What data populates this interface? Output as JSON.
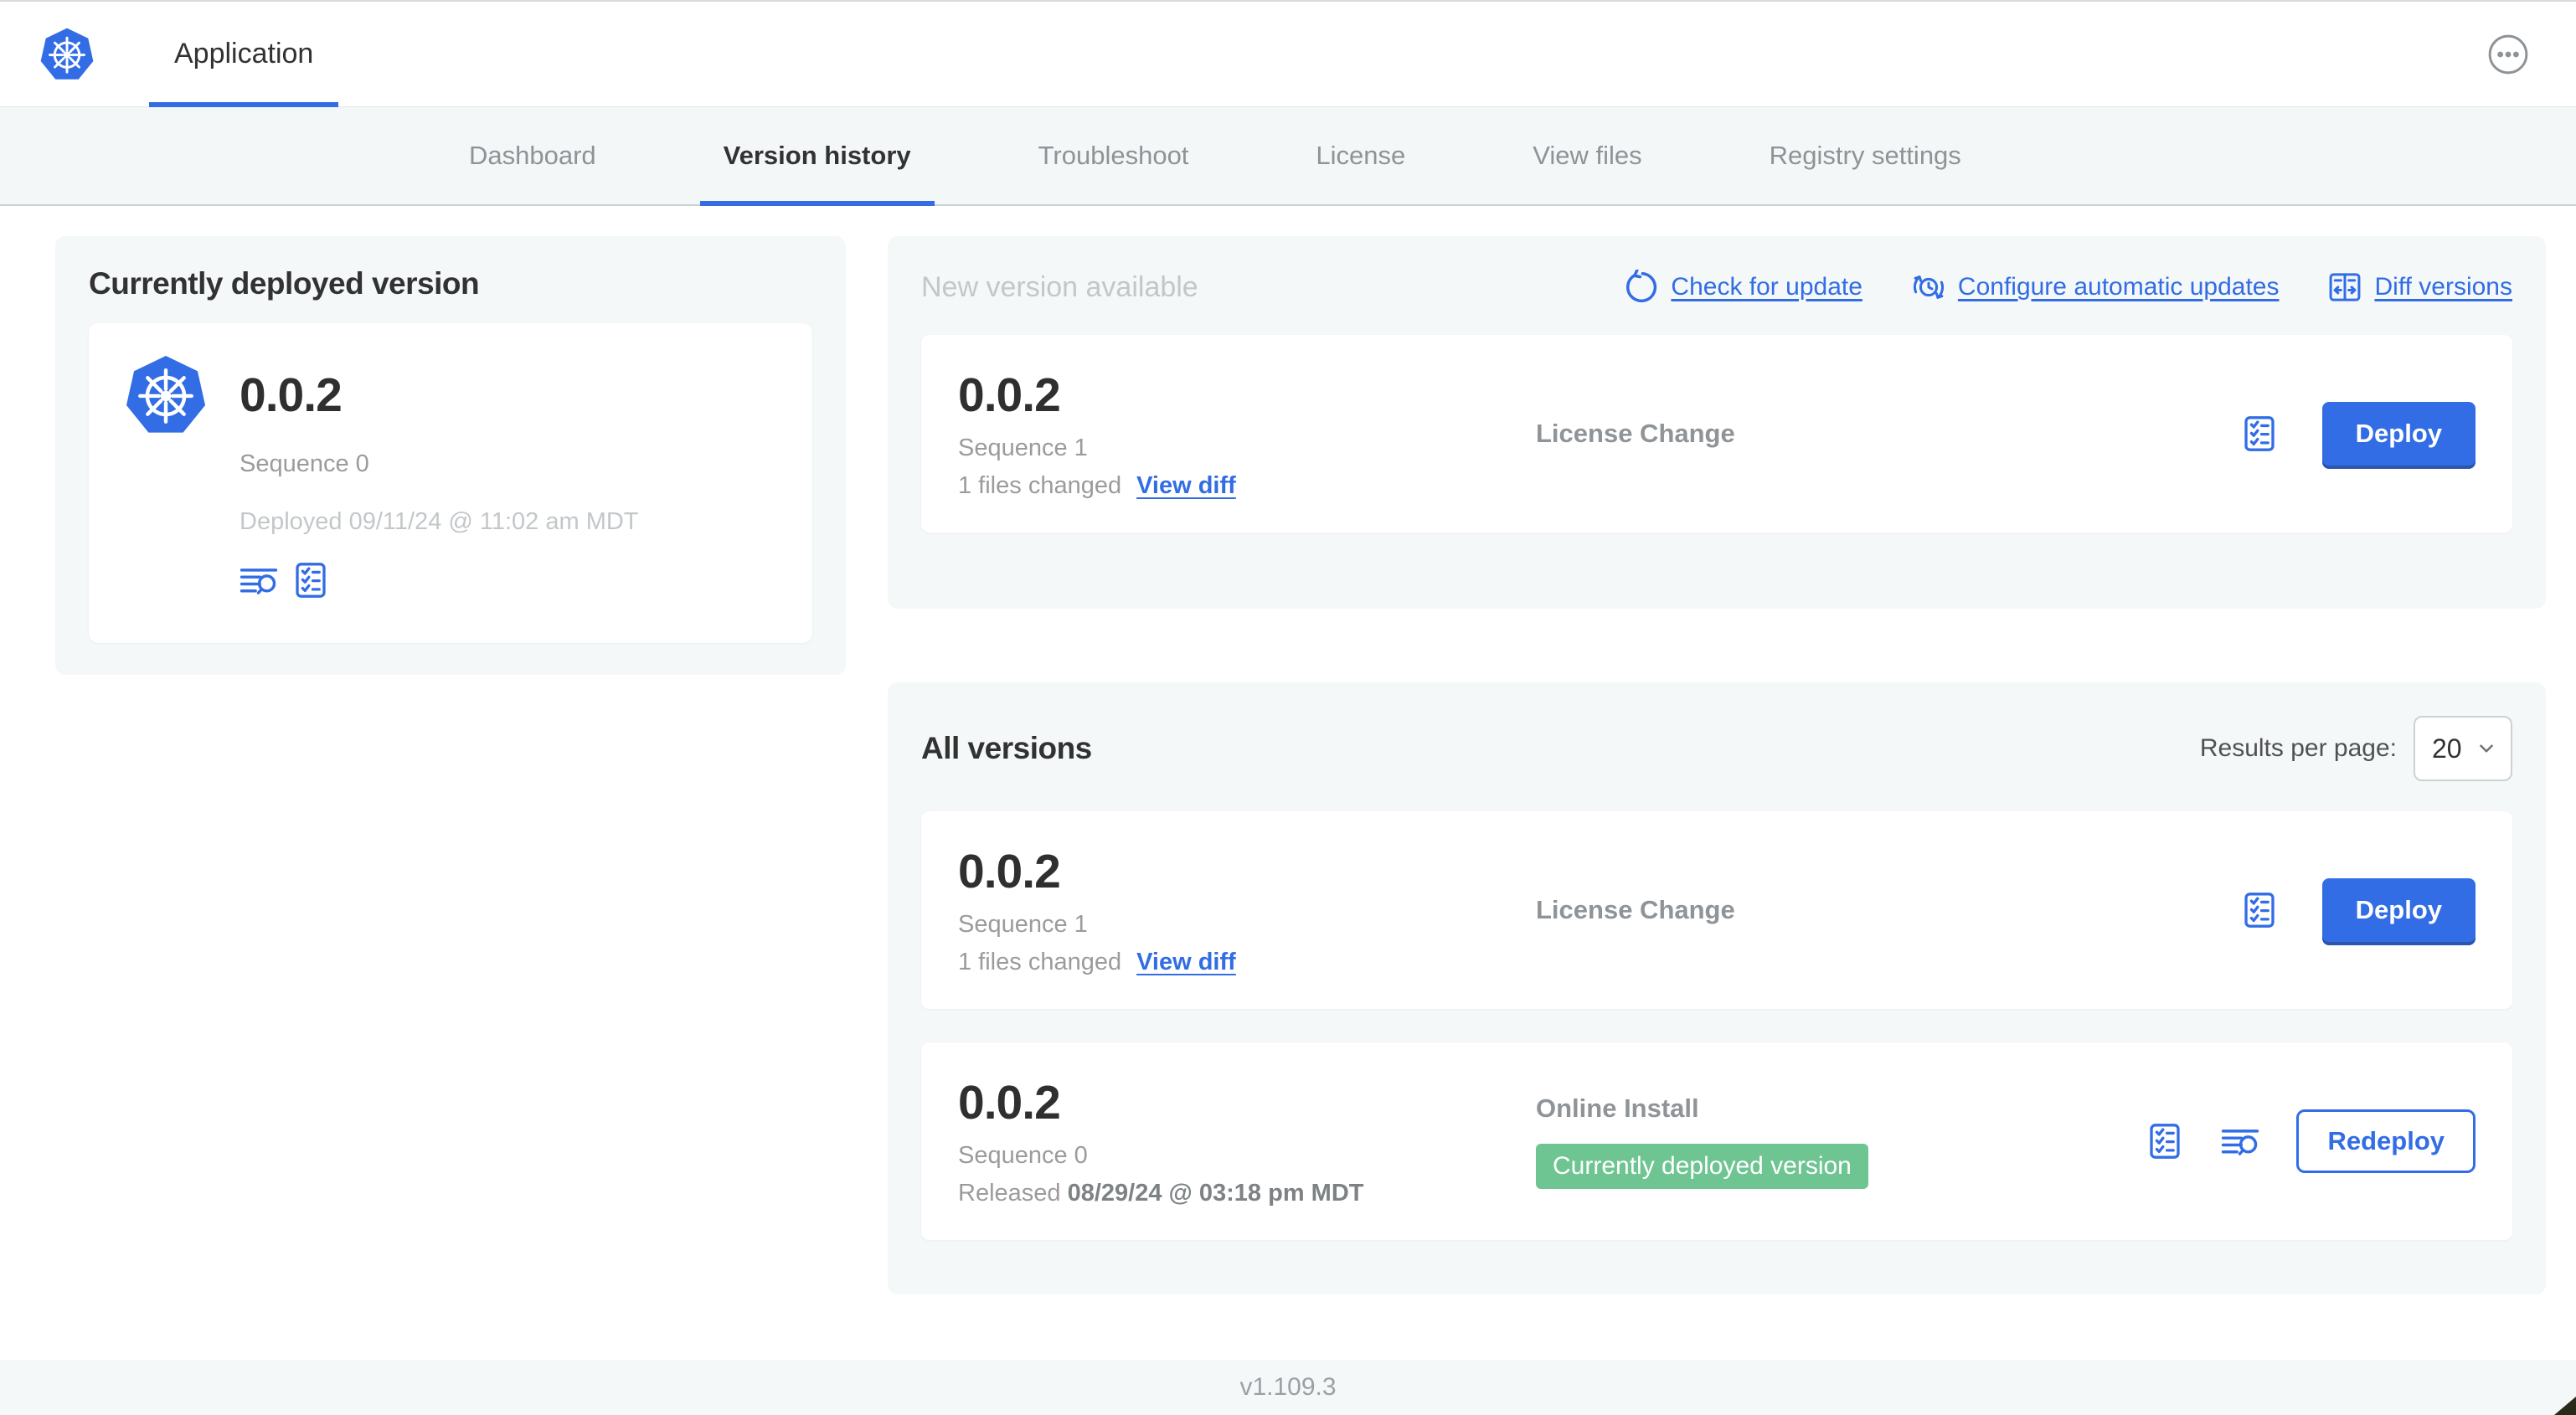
{
  "header": {
    "app_tab_label": "Application"
  },
  "nav": {
    "tabs": [
      {
        "label": "Dashboard"
      },
      {
        "label": "Version history"
      },
      {
        "label": "Troubleshoot"
      },
      {
        "label": "License"
      },
      {
        "label": "View files"
      },
      {
        "label": "Registry settings"
      }
    ]
  },
  "current_version_panel": {
    "title": "Currently deployed version",
    "version": "0.0.2",
    "sequence": "Sequence 0",
    "deployed_timestamp": "Deployed 09/11/24 @ 11:02 am MDT"
  },
  "new_version_panel": {
    "title": "New version available",
    "check_for_update_label": "Check for update",
    "configure_updates_label": "Configure automatic updates",
    "diff_versions_label": "Diff versions",
    "row": {
      "version": "0.0.2",
      "sequence": "Sequence 1",
      "files_changed": "1 files changed",
      "view_diff_label": "View diff",
      "source": "License Change",
      "action_label": "Deploy"
    }
  },
  "all_versions_panel": {
    "title": "All versions",
    "results_per_page_label": "Results per page:",
    "results_per_page_value": "20",
    "rows": [
      {
        "version": "0.0.2",
        "sequence": "Sequence 1",
        "files_changed": "1 files changed",
        "view_diff_label": "View diff",
        "source": "License Change",
        "action_label": "Deploy"
      },
      {
        "version": "0.0.2",
        "sequence": "Sequence 0",
        "released_prefix": "Released",
        "released_timestamp": "08/29/24 @ 03:18 pm MDT",
        "source": "Online Install",
        "badge": "Currently deployed version",
        "action_label": "Redeploy"
      }
    ]
  },
  "footer": {
    "app_manager_version": "v1.109.3"
  },
  "colors": {
    "accent_blue": "#326de5",
    "badge_green": "#6fc592",
    "panel_gray": "#f5f8f9"
  }
}
